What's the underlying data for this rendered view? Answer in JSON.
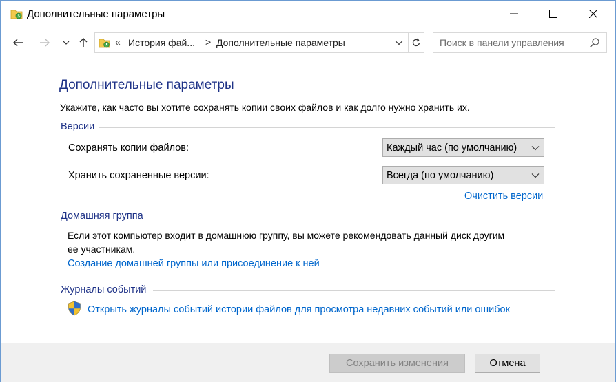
{
  "window": {
    "title": "Дополнительные параметры"
  },
  "nav": {
    "breadcrumb_chevron": "«",
    "breadcrumb_parent": "История фай...",
    "breadcrumb_separator": ">",
    "breadcrumb_current": "Дополнительные параметры",
    "search_placeholder": "Поиск в панели управления"
  },
  "main": {
    "title": "Дополнительные параметры",
    "description": "Укажите, как часто вы хотите сохранять копии своих файлов и как долго нужно хранить их.",
    "versions": {
      "header": "Версии",
      "save_copies_label": "Сохранять копии файлов:",
      "save_copies_value": "Каждый час (по умолчанию)",
      "keep_versions_label": "Хранить сохраненные версии:",
      "keep_versions_value": "Всегда (по умолчанию)",
      "clean_up_link": "Очистить версии"
    },
    "homegroup": {
      "header": "Домашняя группа",
      "text_line1": "Если этот компьютер входит в домашнюю группу, вы можете рекомендовать данный диск другим",
      "text_line2": "ее участникам.",
      "link": "Создание домашней группы или присоединение к ней"
    },
    "event_logs": {
      "header": "Журналы событий",
      "link": "Открыть журналы событий истории файлов для просмотра недавних событий или ошибок"
    }
  },
  "footer": {
    "save_button": "Сохранить изменения",
    "cancel_button": "Отмена"
  },
  "colors": {
    "title_blue": "#1e3287",
    "link_blue": "#0066cc",
    "border_blue": "#6b9bd2"
  }
}
